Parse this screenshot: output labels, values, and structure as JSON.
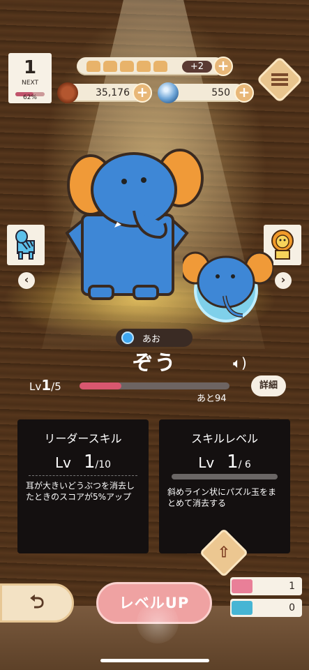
{
  "rank": {
    "value": "1",
    "next_label": "NEXT",
    "next_percent": "62%"
  },
  "stamina": {
    "extra": "+2"
  },
  "currency": {
    "coins": "35,176",
    "gems": "550"
  },
  "character": {
    "attribute": "あお",
    "name": "ぞう",
    "level_prefix": "Lv",
    "level": "1",
    "level_max": "/5",
    "remaining": "あと94",
    "detail_label": "詳細"
  },
  "leader_skill": {
    "title": "リーダースキル",
    "lv_label": "Lv",
    "lv": "1",
    "lv_max": "/10",
    "description": "耳が大きいどうぶつを消去したときのスコアが5%アップ"
  },
  "skill_level": {
    "title": "スキルレベル",
    "lv_label": "Lv",
    "lv": "1",
    "lv_max": "/ 6",
    "description": "斜めライン状にパズル玉をまとめて消去する"
  },
  "buttons": {
    "back": "⮌",
    "level_up": "レベルUP"
  },
  "tickets": {
    "pink": "1",
    "blue": "0"
  }
}
